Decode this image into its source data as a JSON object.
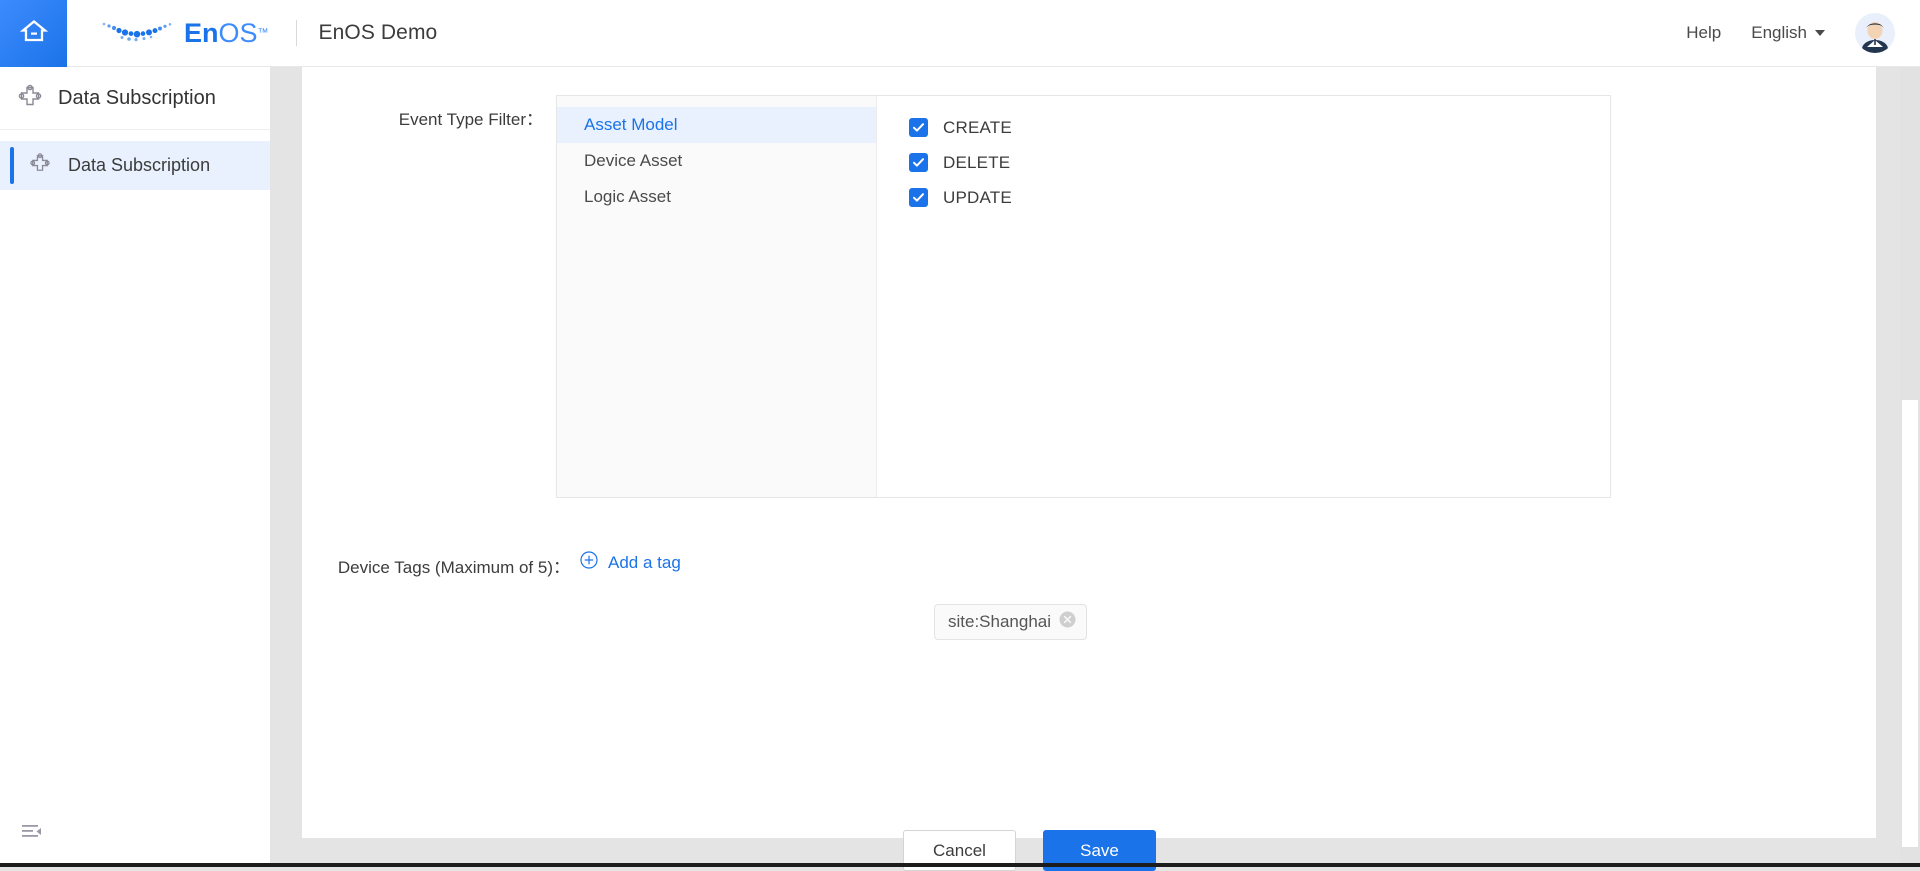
{
  "header": {
    "home_icon": "home-icon",
    "logo_text_en": "En",
    "logo_text_os": "OS",
    "logo_tm": "™",
    "app_title": "EnOS Demo",
    "help_label": "Help",
    "language_label": "English",
    "avatar_icon": "user-avatar",
    "accent_color": "#1a73e8"
  },
  "sidebar": {
    "title": "Data Subscription",
    "title_icon": "subscription-icon",
    "items": [
      {
        "label": "Data Subscription",
        "icon": "subscription-icon",
        "active": true
      }
    ],
    "collapse_icon": "collapse-sidebar-icon"
  },
  "form": {
    "event_type_filter_label": "Event Type Filter：",
    "asset_types": [
      {
        "label": "Asset Model",
        "selected": true
      },
      {
        "label": "Device Asset",
        "selected": false
      },
      {
        "label": "Logic Asset",
        "selected": false
      }
    ],
    "event_types": [
      {
        "label": "CREATE",
        "checked": true
      },
      {
        "label": "DELETE",
        "checked": true
      },
      {
        "label": "UPDATE",
        "checked": true
      }
    ],
    "device_tags_label": "Device Tags (Maximum of 5)：",
    "add_tag_label": "Add a tag",
    "add_tag_icon": "plus-circle-icon",
    "tags": [
      {
        "text": "site:Shanghai",
        "close_icon": "close-circle-icon"
      }
    ]
  },
  "actions": {
    "cancel_label": "Cancel",
    "save_label": "Save"
  }
}
